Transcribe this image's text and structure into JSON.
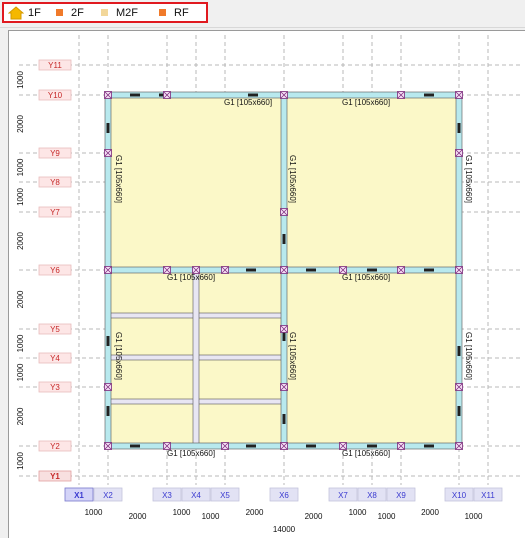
{
  "floor_tabs": [
    {
      "label": "1F",
      "icon": "home-icon",
      "color": "#f5b800",
      "active": true
    },
    {
      "label": "2F",
      "icon": "floor-marker-icon",
      "color": "#f07a2a",
      "active": false
    },
    {
      "label": "M2F",
      "icon": "floor-marker-icon",
      "color": "#f2d79a",
      "active": false
    },
    {
      "label": "RF",
      "icon": "floor-marker-icon",
      "color": "#f07a2a",
      "active": false
    }
  ],
  "grid": {
    "y_axes": [
      "Y11",
      "Y10",
      "Y9",
      "Y8",
      "Y7",
      "Y6",
      "Y5",
      "Y4",
      "Y3",
      "Y2",
      "Y1"
    ],
    "x_axes": [
      "X1",
      "X2",
      "X3",
      "X4",
      "X5",
      "X6",
      "X7",
      "X8",
      "X9",
      "X10",
      "X11"
    ],
    "y_spacing_labels": [
      "1000",
      "2000",
      "1000",
      "1000",
      "2000",
      "2000",
      "1000",
      "1000",
      "2000",
      "1000"
    ],
    "x_spacing_labels": [
      "1000",
      "2000",
      "1000",
      "1000",
      "2000",
      "2000",
      "1000",
      "1000",
      "2000",
      "1000"
    ],
    "x_total": "14000"
  },
  "beam_label": "G1 [105x660]",
  "colors": {
    "slab": "#fbf8c8",
    "beam": "#b8e9ee",
    "active_axis": "#d4d4f8",
    "axis_tag_y_bg": "#fde0e0",
    "axis_tag_x_bg": "#e2e2f4"
  }
}
